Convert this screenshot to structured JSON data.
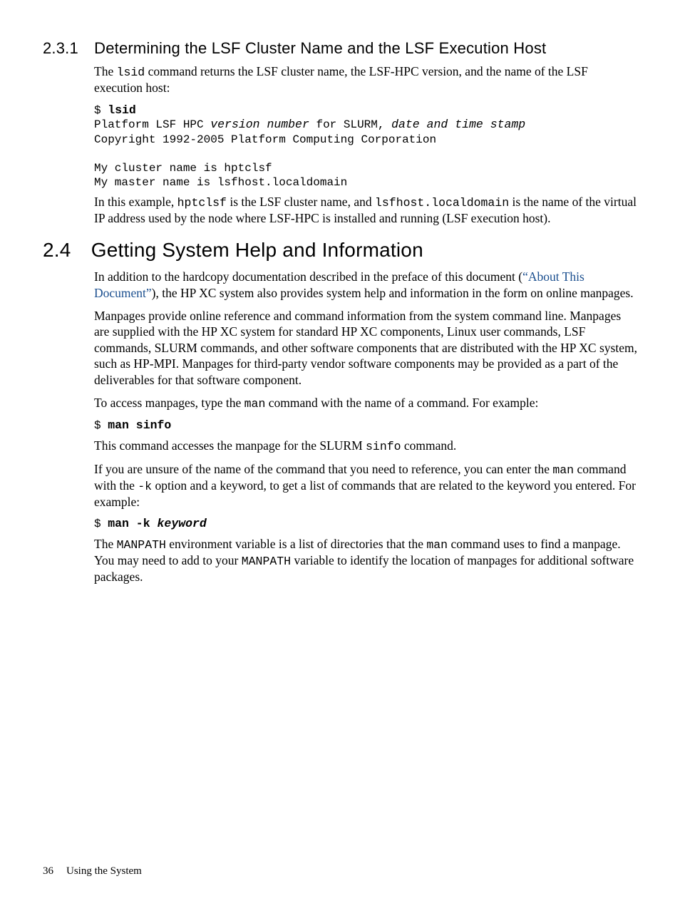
{
  "section231": {
    "heading": "2.3.1 Determining the LSF Cluster Name and the LSF Execution Host",
    "p1a": "The ",
    "p1_code": "lsid",
    "p1b": " command returns the LSF cluster name, the LSF-HPC version, and the name of the LSF execution host:",
    "code": {
      "l1a": "$ ",
      "l1b": "lsid",
      "l2a": "Platform LSF HPC ",
      "l2b": "version number",
      "l2c": " for SLURM, ",
      "l2d": "date and time stamp",
      "l3": "Copyright 1992-2005 Platform Computing Corporation",
      "l4": "",
      "l5": "My cluster name is hptclsf",
      "l6": "My master name is lsfhost.localdomain"
    },
    "p2a": "In this example, ",
    "p2_code1": "hptclsf",
    "p2b": " is the LSF cluster name, and ",
    "p2_code2": "lsfhost.localdomain",
    "p2c": " is the name of the virtual IP address used by the node where LSF-HPC is installed and running (LSF execution host)."
  },
  "section24": {
    "heading": "2.4 Getting System Help and Information",
    "p1a": "In addition to the hardcopy documentation described in the preface of this document (",
    "p1_link": "“About This Document”",
    "p1b": "), the HP XC system also provides system help and information in the form on online manpages.",
    "p2": "Manpages provide online reference and command information from the system command line. Manpages are supplied with the HP XC system for standard HP XC components, Linux user commands, LSF commands, SLURM commands, and other software components that are distributed with the HP XC system, such as HP-MPI. Manpages for third-party vendor software components may be provided as a part of the deliverables for that software component.",
    "p3a": "To access manpages, type the ",
    "p3_code": "man",
    "p3b": " command with the name of a command. For example:",
    "code1a": "$ ",
    "code1b": "man sinfo",
    "p4a": "This command accesses the manpage for the SLURM ",
    "p4_code": "sinfo",
    "p4b": " command.",
    "p5a": "If you are unsure of the name of the command that you need to reference, you can enter the ",
    "p5_code1": "man",
    "p5b": " command with the ",
    "p5_code2": "-k",
    "p5c": " option and a keyword, to get a list of commands that are related to the keyword you entered. For example:",
    "code2a": "$ ",
    "code2b": "man -k ",
    "code2c": "keyword",
    "p6a": "The ",
    "p6_code1": "MANPATH",
    "p6b": " environment variable is a list of directories that the ",
    "p6_code2": "man",
    "p6c": " command uses to find a manpage. You may need to add to your ",
    "p6_code3": "MANPATH",
    "p6d": " variable to identify the location of manpages for additional software packages."
  },
  "footer": {
    "page": "36",
    "title": "Using the System"
  }
}
